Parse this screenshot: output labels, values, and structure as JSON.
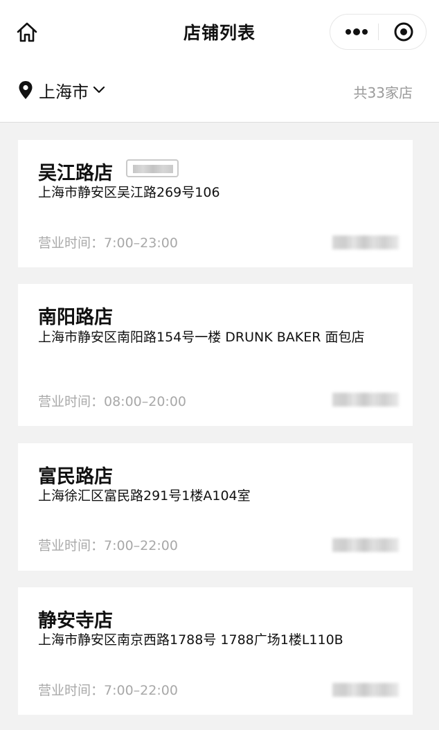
{
  "header": {
    "title": "店铺列表",
    "home_icon": "home-icon",
    "more_icon": "more-dots-icon",
    "close_icon": "target-close-icon"
  },
  "city_bar": {
    "city": "上海市",
    "count_text": "共33家店",
    "location_icon": "location-pin-icon",
    "chevron_icon": "chevron-down-icon"
  },
  "stores": [
    {
      "name": "吴江路店",
      "address": "上海市静安区吴江路269号106",
      "hours": "营业时间：7:00–23:00"
    },
    {
      "name": "南阳路店",
      "address": "上海市静安区南阳路154号一楼 DRUNK BAKER 面包店",
      "hours": "营业时间：08:00–20:00"
    },
    {
      "name": "富民路店",
      "address": "上海徐汇区富民路291号1楼A104室",
      "hours": "营业时间：7:00–22:00"
    },
    {
      "name": "静安寺店",
      "address": "上海市静安区南京西路1788号 1788广场1楼L110B",
      "hours": "营业时间：7:00–22:00"
    }
  ],
  "colors": {
    "background": "#f2f2f2",
    "card": "#ffffff",
    "muted_text": "#a8a8a8",
    "count_text": "#9a9a9a"
  }
}
